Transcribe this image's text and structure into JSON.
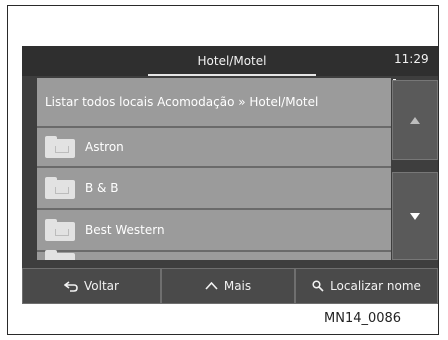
{
  "header": {
    "title": "Hotel/Motel",
    "clock": "11:29"
  },
  "list": {
    "header_text": "Listar todos locais Acomodação » Hotel/Motel",
    "items": [
      {
        "label": "Astron",
        "icon": "folder-icon"
      },
      {
        "label": "B & B",
        "icon": "folder-icon"
      },
      {
        "label": "Best Western",
        "icon": "folder-icon"
      }
    ]
  },
  "side_buttons": {
    "up_icon": "arrow-up-icon",
    "down_icon": "arrow-down-icon"
  },
  "bottom_bar": {
    "back_label": "Voltar",
    "more_label": "Mais",
    "search_label": "Localizar nome"
  },
  "caption": "MN14_0086"
}
